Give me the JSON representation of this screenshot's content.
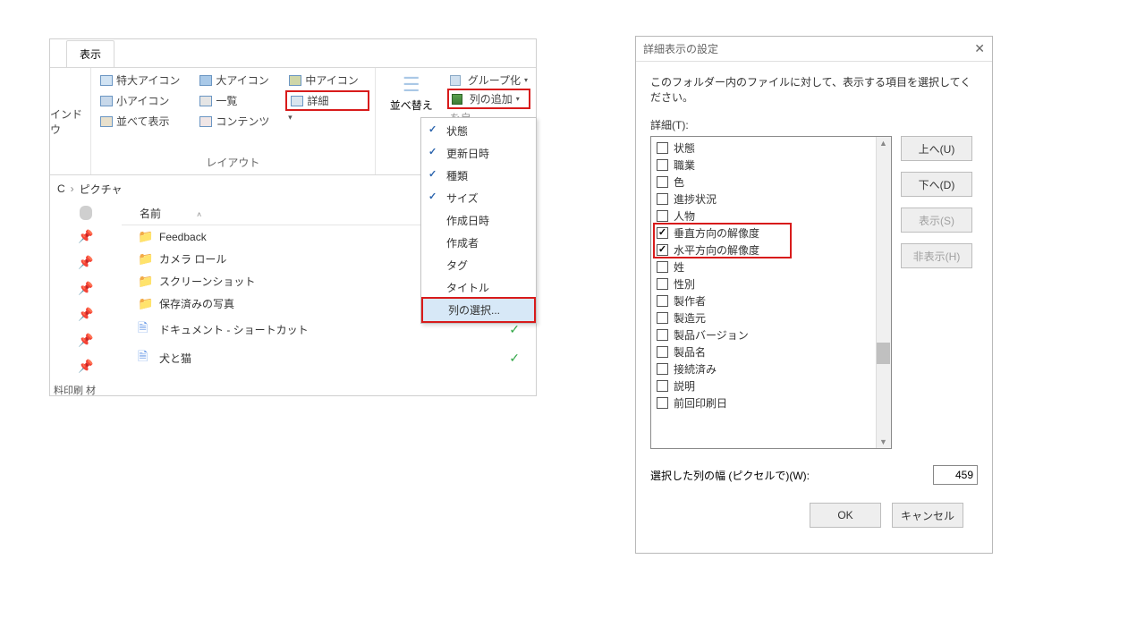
{
  "explorer": {
    "tab": "表示",
    "nav_left": "インドウ",
    "layout_items": {
      "xl": "特大アイコン",
      "l": "大アイコン",
      "m": "中アイコン",
      "s": "小アイコン",
      "list": "一覧",
      "details": "詳細",
      "tiles": "並べて表示",
      "content": "コンテンツ"
    },
    "layout_group_label": "レイアウト",
    "sort": {
      "sort_by": "並べ替え",
      "group_by": "グループ化",
      "add_columns": "列の追加",
      "fit": "を自"
    },
    "menu": {
      "state": "状態",
      "modified": "更新日時",
      "kind": "種類",
      "size": "サイズ",
      "created": "作成日時",
      "author": "作成者",
      "tag": "タグ",
      "title": "タイトル",
      "choose": "列の選択..."
    },
    "breadcrumb": {
      "c": "C",
      "sep": "›",
      "pic": "ピクチャ"
    },
    "col_name": "名前",
    "files": [
      "Feedback",
      "カメラ ロール",
      "スクリーンショット",
      "保存済みの写真",
      "ドキュメント - ショートカット",
      "犬と猫"
    ],
    "nav_side": "料印刷   材"
  },
  "dialog": {
    "title": "詳細表示の設定",
    "instr": "このフォルダー内のファイルに対して、表示する項目を選択してください。",
    "details_label": "詳細(T):",
    "items": [
      {
        "label": "状態",
        "checked": false
      },
      {
        "label": "職業",
        "checked": false
      },
      {
        "label": "色",
        "checked": false
      },
      {
        "label": "進捗状況",
        "checked": false
      },
      {
        "label": "人物",
        "checked": false
      },
      {
        "label": "垂直方向の解像度",
        "checked": true,
        "hl": true
      },
      {
        "label": "水平方向の解像度",
        "checked": true,
        "hl": true
      },
      {
        "label": "姓",
        "checked": false
      },
      {
        "label": "性別",
        "checked": false
      },
      {
        "label": "製作者",
        "checked": false
      },
      {
        "label": "製造元",
        "checked": false
      },
      {
        "label": "製品バージョン",
        "checked": false
      },
      {
        "label": "製品名",
        "checked": false
      },
      {
        "label": "接続済み",
        "checked": false
      },
      {
        "label": "説明",
        "checked": false
      },
      {
        "label": "前回印刷日",
        "checked": false
      }
    ],
    "buttons": {
      "up": "上へ(U)",
      "down": "下へ(D)",
      "show": "表示(S)",
      "hide": "非表示(H)"
    },
    "width_label": "選択した列の幅 (ピクセルで)(W):",
    "width_value": "459",
    "ok": "OK",
    "cancel": "キャンセル"
  }
}
